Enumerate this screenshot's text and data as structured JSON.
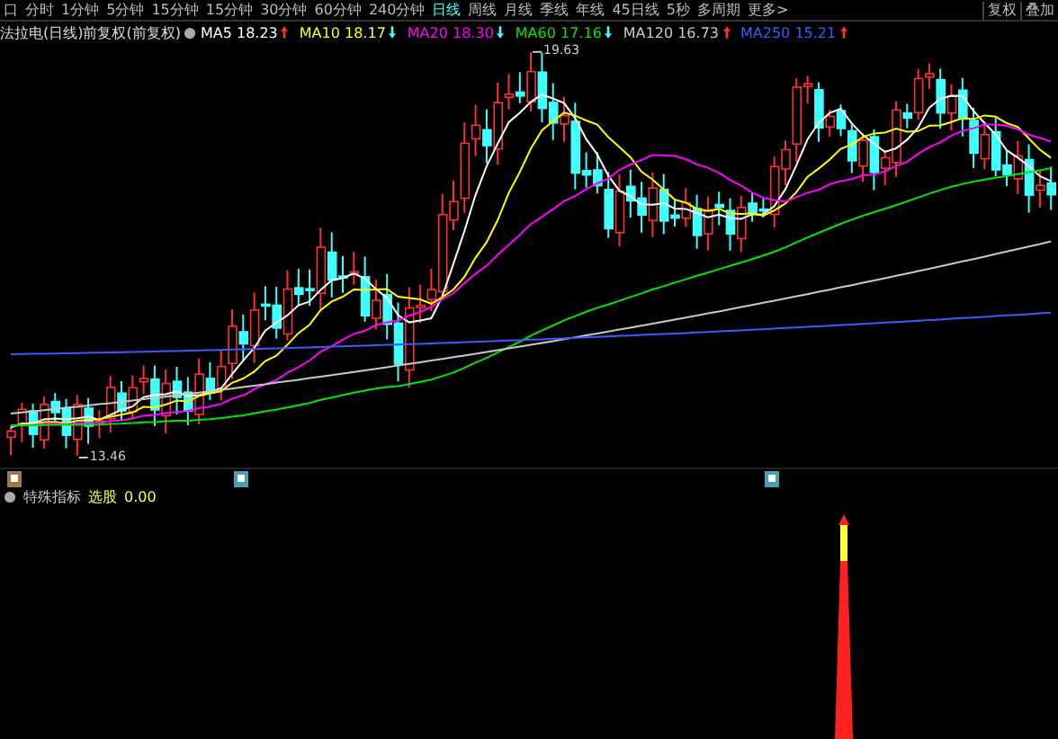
{
  "toolbar": {
    "tabs": [
      {
        "label": "口",
        "selected": false
      },
      {
        "label": "分时",
        "selected": false
      },
      {
        "label": "1分钟",
        "selected": false
      },
      {
        "label": "5分钟",
        "selected": false
      },
      {
        "label": "15分钟",
        "selected": false
      },
      {
        "label": "15分钟",
        "selected": false
      },
      {
        "label": "30分钟",
        "selected": false
      },
      {
        "label": "60分钟",
        "selected": false
      },
      {
        "label": "240分钟",
        "selected": false
      },
      {
        "label": "日线",
        "selected": true
      },
      {
        "label": "周线",
        "selected": false
      },
      {
        "label": "月线",
        "selected": false
      },
      {
        "label": "季线",
        "selected": false
      },
      {
        "label": "年线",
        "selected": false
      },
      {
        "label": "45日线",
        "selected": false
      },
      {
        "label": "5秒",
        "selected": false
      },
      {
        "label": "多周期",
        "selected": false
      },
      {
        "label": "更多>",
        "selected": false
      }
    ],
    "buttons": [
      "复权",
      "叠加"
    ]
  },
  "main_chart": {
    "title": "法拉电(日线)前复权(前复权)",
    "moving_averages": [
      {
        "name": "MA5",
        "value": "18.23",
        "rising": true,
        "color": "#ffffff"
      },
      {
        "name": "MA10",
        "value": "18.17",
        "rising": false,
        "color": "#ffff00"
      },
      {
        "name": "MA20",
        "value": "18.30",
        "rising": false,
        "color": "#ff00ff"
      },
      {
        "name": "MA60",
        "value": "17.16",
        "rising": false,
        "color": "#00e600"
      },
      {
        "name": "MA120",
        "value": "16.73",
        "rising": true,
        "color": "#c8c8c8"
      },
      {
        "name": "MA250",
        "value": "15.21",
        "rising": true,
        "color": "#3a5cff"
      }
    ],
    "high_label": "19.63",
    "low_label": "13.46"
  },
  "indicator": {
    "name": "特殊指标",
    "items": [
      {
        "label": "选股",
        "value": "0.00"
      }
    ]
  }
}
